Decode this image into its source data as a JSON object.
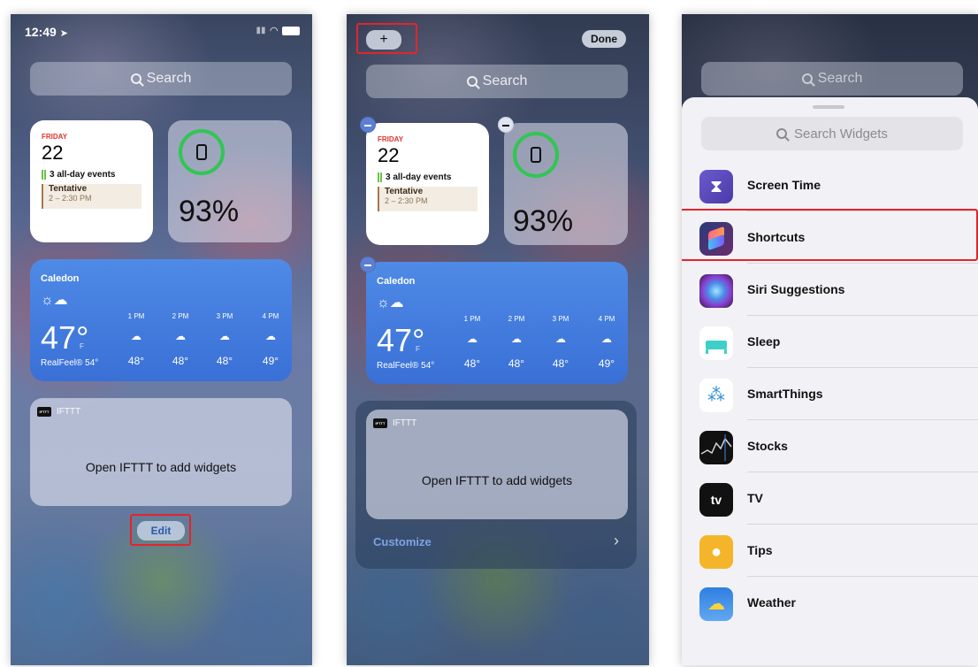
{
  "panel1": {
    "status_time": "12:49",
    "search_label": "Search",
    "calendar": {
      "day": "FRIDAY",
      "date": "22",
      "events": "3 all-day events",
      "event_title": "Tentative",
      "event_time": "2 – 2:30 PM"
    },
    "battery": {
      "percent": "93%"
    },
    "weather": {
      "city": "Caledon",
      "temp": "47°",
      "unit": "F",
      "realfeel": "RealFeel® 54°",
      "hours": [
        "1 PM",
        "2 PM",
        "3 PM",
        "4 PM"
      ],
      "temps": [
        "48°",
        "48°",
        "48°",
        "49°"
      ]
    },
    "ifttt": {
      "name": "IFTTT",
      "message": "Open IFTTT to add widgets"
    },
    "edit_label": "Edit"
  },
  "panel2": {
    "plus_label": "+",
    "done_label": "Done",
    "search_label": "Search",
    "calendar": {
      "day": "FRIDAY",
      "date": "22",
      "events": "3 all-day events",
      "event_title": "Tentative",
      "event_time": "2 – 2:30 PM"
    },
    "battery": {
      "percent": "93%"
    },
    "weather": {
      "city": "Caledon",
      "temp": "47°",
      "unit": "F",
      "realfeel": "RealFeel® 54°",
      "hours": [
        "1 PM",
        "2 PM",
        "3 PM",
        "4 PM"
      ],
      "temps": [
        "48°",
        "48°",
        "48°",
        "49°"
      ]
    },
    "ifttt": {
      "name": "IFTTT",
      "message": "Open IFTTT to add widgets"
    },
    "customize_label": "Customize"
  },
  "panel3": {
    "search_label": "Search",
    "widget_search_label": "Search Widgets",
    "apps": [
      "Screen Time",
      "Shortcuts",
      "Siri Suggestions",
      "Sleep",
      "SmartThings",
      "Stocks",
      "TV",
      "Tips",
      "Weather"
    ]
  },
  "colors": {
    "highlight": "#e4242b",
    "ring_green": "#31c653",
    "weather_blue": "#4f8ae6"
  }
}
